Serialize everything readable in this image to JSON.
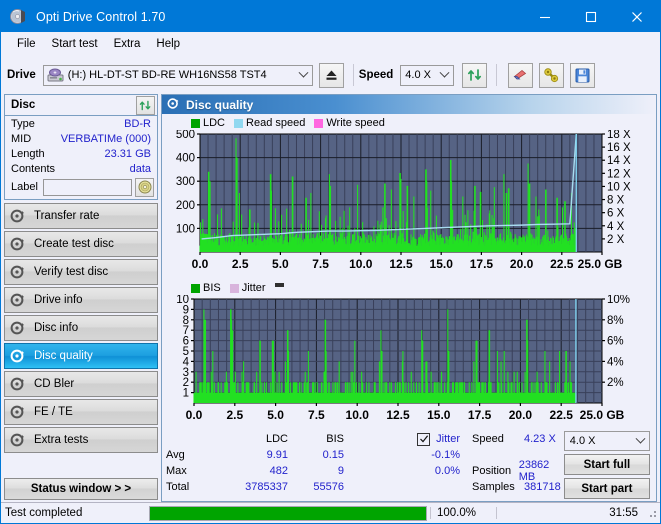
{
  "window": {
    "title": "Opti Drive Control 1.70",
    "icon": "disc-icon",
    "minimize": "minimize-icon",
    "maximize": "maximize-icon",
    "close": "close-icon"
  },
  "menu": {
    "items": [
      {
        "label": "File"
      },
      {
        "label": "Start test"
      },
      {
        "label": "Extra"
      },
      {
        "label": "Help"
      }
    ]
  },
  "toolbar": {
    "drive_label": "Drive",
    "drive_value": "(H:)  HL-DT-ST BD-RE  WH16NS58 TST4",
    "drive_icon": "drive-icon",
    "eject_icon": "eject-icon",
    "speed_label": "Speed",
    "speed_value": "4.0 X",
    "refresh_icon": "refresh-icon",
    "erase_icon": "eraser-icon",
    "tools_icon": "wrench-icon",
    "save_icon": "floppy-save-icon"
  },
  "disc_panel": {
    "title": "Disc",
    "refresh_icon": "refresh-icon",
    "rows": [
      {
        "key": "Type",
        "value": "BD-R"
      },
      {
        "key": "MID",
        "value": "VERBATIMe (000)"
      },
      {
        "key": "Length",
        "value": "23.31 GB"
      },
      {
        "key": "Contents",
        "value": "data"
      }
    ],
    "label_key": "Label",
    "label_value": "",
    "label_placeholder": "",
    "label_button_icon": "cd-disc-icon"
  },
  "sidebar": {
    "items": [
      {
        "label": "Transfer rate",
        "icon": "disc-spin-icon",
        "active": false
      },
      {
        "label": "Create test disc",
        "icon": "disc-spin-icon",
        "active": false
      },
      {
        "label": "Verify test disc",
        "icon": "disc-spin-icon",
        "active": false
      },
      {
        "label": "Drive info",
        "icon": "disc-spin-icon",
        "active": false
      },
      {
        "label": "Disc info",
        "icon": "disc-spin-icon",
        "active": false
      },
      {
        "label": "Disc quality",
        "icon": "disc-spin-icon",
        "active": true
      },
      {
        "label": "CD Bler",
        "icon": "disc-spin-icon",
        "active": false
      },
      {
        "label": "FE / TE",
        "icon": "disc-spin-icon",
        "active": false
      },
      {
        "label": "Extra tests",
        "icon": "disc-spin-icon",
        "active": false
      }
    ],
    "status_window_label": "Status window > >"
  },
  "content": {
    "header_title": "Disc quality",
    "header_icon": "disc-spin-icon"
  },
  "colors": {
    "accent": "#0078d7",
    "plot_bg": "#566384",
    "ldc_green": "#1ee01e",
    "read_speed": "#a8dcf0",
    "write_speed": "#ff7fe8",
    "jitter": "#d8b4dc",
    "value_blue": "#2222cc",
    "progress_green": "#00a400"
  },
  "chart_data": [
    {
      "type": "line",
      "title": "LDC / Read speed",
      "xlabel": "GB",
      "ylabel": "LDC",
      "y2label": "X",
      "xlim": [
        0,
        25.0
      ],
      "ylim": [
        0,
        500
      ],
      "y2lim": [
        0,
        18
      ],
      "xticks": [
        "0.0",
        "2.5",
        "5.0",
        "7.5",
        "10.0",
        "12.5",
        "15.0",
        "17.5",
        "20.0",
        "22.5",
        "25.0 GB"
      ],
      "yticks": [
        100,
        200,
        300,
        400,
        500
      ],
      "y2ticks": [
        "2 X",
        "4 X",
        "6 X",
        "8 X",
        "10 X",
        "12 X",
        "14 X",
        "16 X",
        "18 X"
      ],
      "grid": true,
      "legend_position": "top-left",
      "series": [
        {
          "name": "LDC",
          "color": "#1ee01e",
          "kind": "bar"
        },
        {
          "name": "Read speed",
          "color": "#a8dcf0",
          "kind": "line"
        },
        {
          "name": "Write speed",
          "color": "#ff7fe8",
          "kind": "line"
        }
      ],
      "read_speed_points": [
        [
          0.1,
          2.0
        ],
        [
          1.0,
          2.2
        ],
        [
          2.0,
          2.5
        ],
        [
          3.0,
          2.6
        ],
        [
          4.0,
          2.7
        ],
        [
          5.0,
          2.8
        ],
        [
          6.0,
          3.0
        ],
        [
          7.0,
          3.1
        ],
        [
          8.0,
          3.2
        ],
        [
          9.0,
          3.2
        ],
        [
          10.0,
          3.25
        ],
        [
          11.0,
          3.3
        ],
        [
          12.0,
          3.4
        ],
        [
          13.0,
          3.5
        ],
        [
          14.0,
          3.6
        ],
        [
          15.0,
          3.7
        ],
        [
          16.0,
          3.8
        ],
        [
          17.0,
          3.9
        ],
        [
          18.0,
          4.0
        ],
        [
          19.0,
          4.05
        ],
        [
          20.0,
          4.1
        ],
        [
          21.0,
          4.2
        ],
        [
          22.0,
          4.25
        ],
        [
          23.0,
          4.3
        ],
        [
          23.4,
          18.0
        ]
      ],
      "ldc_max": 482,
      "ldc_avg": 9.91
    },
    {
      "type": "bar",
      "title": "BIS / Jitter",
      "xlabel": "GB",
      "ylabel": "BIS",
      "y2label": "%",
      "xlim": [
        0,
        25.0
      ],
      "ylim": [
        0,
        10
      ],
      "y2lim": [
        0,
        10
      ],
      "xticks": [
        "0.0",
        "2.5",
        "5.0",
        "7.5",
        "10.0",
        "12.5",
        "15.0",
        "17.5",
        "20.0",
        "22.5",
        "25.0 GB"
      ],
      "yticks": [
        1,
        2,
        3,
        4,
        5,
        6,
        7,
        8,
        9,
        10
      ],
      "y2ticks": [
        "2%",
        "4%",
        "6%",
        "8%",
        "10%"
      ],
      "grid": true,
      "legend_position": "top-left",
      "series": [
        {
          "name": "BIS",
          "color": "#1ee01e",
          "kind": "bar"
        },
        {
          "name": "Jitter",
          "color": "#d8b4dc",
          "kind": "line"
        }
      ],
      "bis_max": 9,
      "bis_avg": 0.15
    }
  ],
  "stats": {
    "headers": {
      "ldc": "LDC",
      "bis": "BIS",
      "jitter": "Jitter"
    },
    "jitter_checked": true,
    "rows": [
      {
        "name": "Avg",
        "ldc": "9.91",
        "bis": "0.15",
        "jitter": "-0.1%"
      },
      {
        "name": "Max",
        "ldc": "482",
        "bis": "9",
        "jitter": "0.0%"
      },
      {
        "name": "Total",
        "ldc": "3785337",
        "bis": "55576",
        "jitter": ""
      }
    ],
    "speed_label": "Speed",
    "speed_value": "4.23 X",
    "position_label": "Position",
    "position_value": "23862 MB",
    "samples_label": "Samples",
    "samples_value": "381718",
    "speed_select": "4.0 X",
    "start_full_label": "Start full",
    "start_part_label": "Start part"
  },
  "statusbar": {
    "text": "Test completed",
    "percent": "100.0%",
    "progress": 100,
    "elapsed": "31:55"
  }
}
